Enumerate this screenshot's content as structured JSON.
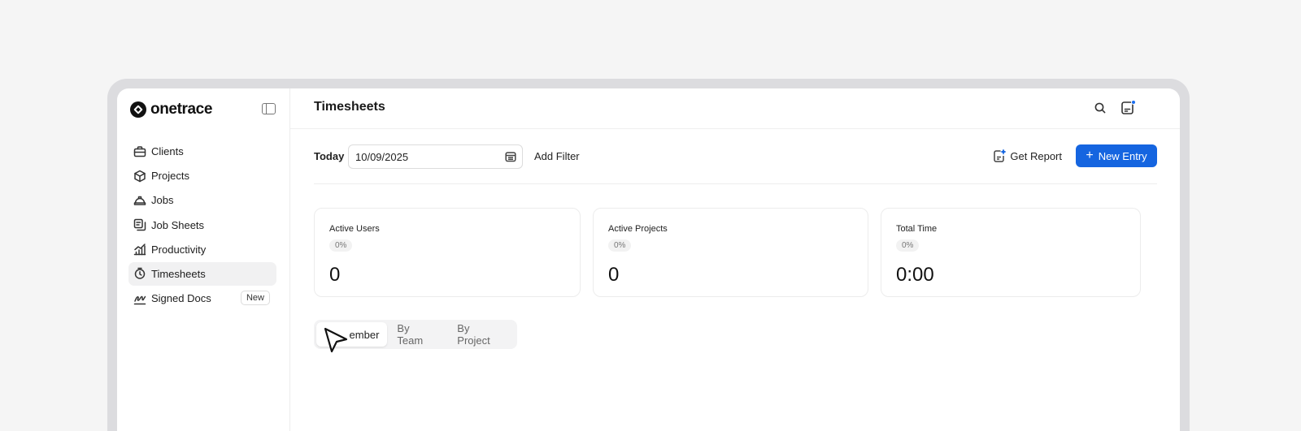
{
  "brand": {
    "name": "onetrace"
  },
  "sidebar": {
    "items": [
      {
        "label": "Clients",
        "icon": "briefcase-icon"
      },
      {
        "label": "Projects",
        "icon": "cube-icon"
      },
      {
        "label": "Jobs",
        "icon": "hardhat-icon"
      },
      {
        "label": "Job Sheets",
        "icon": "sheets-icon"
      },
      {
        "label": "Productivity",
        "icon": "chart-icon"
      },
      {
        "label": "Timesheets",
        "icon": "clock-icon",
        "active": true
      },
      {
        "label": "Signed Docs",
        "icon": "signature-icon",
        "badge": "New"
      }
    ]
  },
  "header": {
    "title": "Timesheets"
  },
  "toolbar": {
    "today_label": "Today",
    "date_value": "10/09/2025",
    "add_filter": "Add Filter",
    "get_report": "Get Report",
    "new_entry": "New Entry"
  },
  "stats": [
    {
      "label": "Active Users",
      "pct": "0%",
      "value": "0"
    },
    {
      "label": "Active Projects",
      "pct": "0%",
      "value": "0"
    },
    {
      "label": "Total Time",
      "pct": "0%",
      "value": "0:00"
    }
  ],
  "tabs": [
    {
      "label": "ember",
      "active": true
    },
    {
      "label": "By Team"
    },
    {
      "label": "By Project"
    }
  ],
  "colors": {
    "accent": "#1565e0",
    "notification": "#1a6ef0"
  }
}
